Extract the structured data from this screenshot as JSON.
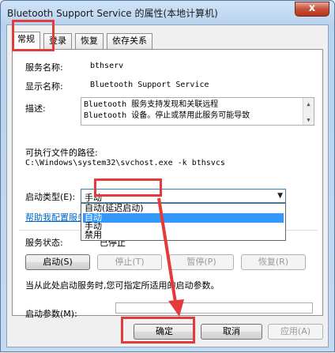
{
  "window": {
    "title": "Bluetooth Support Service 的属性(本地计算机)",
    "close_symbol": "x"
  },
  "tabs": [
    {
      "label": "常规",
      "active": true
    },
    {
      "label": "登录",
      "active": false
    },
    {
      "label": "恢复",
      "active": false
    },
    {
      "label": "依存关系",
      "active": false
    }
  ],
  "general": {
    "service_name_label": "服务名称:",
    "service_name_value": "bthserv",
    "display_name_label": "显示名称:",
    "display_name_value": "Bluetooth Support Service",
    "description_label": "描述:",
    "description_lines": [
      "Bluetooth 服务支持发现和关联远程",
      "Bluetooth 设备。停止或禁用此服务可能导致"
    ],
    "exe_path_label": "可执行文件的路径:",
    "exe_path_value": "C:\\Windows\\system32\\svchost.exe -k bthsvcs",
    "startup_type_label": "启动类型(E):",
    "startup_type_selected": "手动",
    "startup_type_options": [
      "自动(延迟启动)",
      "自动",
      "手动",
      "禁用"
    ],
    "help_link": "帮助我配置服务启动",
    "service_status_label": "服务状态:",
    "service_status_value": "已停止",
    "start_button": "启动(S)",
    "stop_button": "停止(T)",
    "pause_button": "暂停(P)",
    "resume_button": "恢复(R)",
    "hint_text": "当从此处启动服务时,您可指定所适用的启动参数。",
    "start_params_label": "启动参数(M):"
  },
  "footer": {
    "ok_button": "确定",
    "cancel_button": "取消",
    "apply_button": "应用(A)"
  },
  "colors": {
    "highlight": "#e53a3a",
    "selection": "#3399ff",
    "link": "#0066cc"
  }
}
